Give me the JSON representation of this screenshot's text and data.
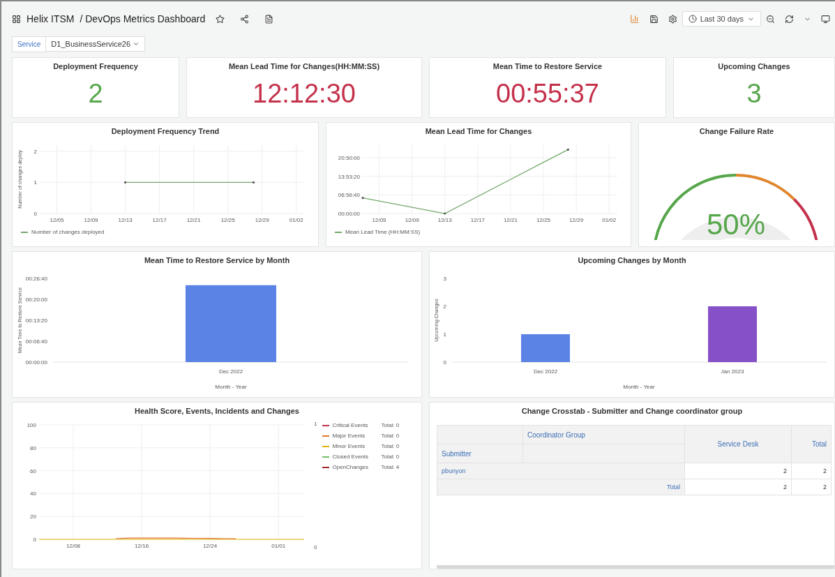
{
  "header": {
    "folder": "Helix ITSM",
    "title": "/ DevOps Metrics Dashboard",
    "time_range": "Last 30 days"
  },
  "variables": [
    {
      "label": "Service",
      "value": "D1_BusinessService26"
    }
  ],
  "stats": [
    {
      "title": "Deployment Frequency",
      "value": "2",
      "color": "#56a64b"
    },
    {
      "title": "Mean Lead Time for Changes(HH:MM:SS)",
      "value": "12:12:30",
      "color": "#c4314b"
    },
    {
      "title": "Mean Time to Restore Service",
      "value": "00:55:37",
      "color": "#c4314b"
    },
    {
      "title": "Upcoming Changes",
      "value": "3",
      "color": "#56a64b"
    }
  ],
  "deployment_trend": {
    "title": "Deployment Frequency Trend",
    "chart_data": {
      "type": "line",
      "grid": true,
      "ylabel": "Number of changes deploy",
      "ylim": [
        0,
        2.2
      ],
      "yticks": [
        0,
        1,
        2
      ],
      "categories": [
        null,
        null,
        "12/05",
        null,
        null,
        null,
        "12/09",
        null,
        null,
        null,
        "12/13",
        null,
        null,
        null,
        "12/17",
        null,
        null,
        null,
        "12/21",
        null,
        null,
        null,
        "12/25",
        null,
        null,
        null,
        "12/29",
        null,
        null,
        null,
        "01/02",
        null
      ],
      "series": [
        {
          "name": "Number of changes deployed",
          "color": "#73a86a",
          "values": [
            null,
            null,
            null,
            null,
            null,
            null,
            null,
            null,
            null,
            null,
            1,
            null,
            null,
            null,
            null,
            null,
            null,
            null,
            null,
            null,
            null,
            null,
            null,
            null,
            null,
            1,
            null,
            null,
            null,
            null,
            null,
            null
          ]
        }
      ]
    }
  },
  "lead_time": {
    "title": "Mean Lead Time for Changes",
    "chart_data": {
      "type": "line",
      "grid": true,
      "ylim": [
        0,
        92000
      ],
      "yticks": [
        {
          "value": 0,
          "label": "00:00:00"
        },
        {
          "value": 25000,
          "label": "06:56:40"
        },
        {
          "value": 50000,
          "label": "13:53:20"
        },
        {
          "value": 75000,
          "label": "20:50:00"
        }
      ],
      "categories": [
        null,
        null,
        "12/05",
        null,
        null,
        null,
        "12/09",
        null,
        null,
        null,
        "12/13",
        null,
        null,
        null,
        "12/17",
        null,
        null,
        null,
        "12/21",
        null,
        null,
        null,
        "12/25",
        null,
        null,
        null,
        "12/29",
        null,
        null,
        null,
        "01/02",
        null
      ],
      "series": [
        {
          "name": "Mean Lead Time (HH:MM:SS)",
          "color": "#73a86a",
          "values": [
            21000,
            null,
            null,
            null,
            null,
            null,
            null,
            null,
            null,
            null,
            0,
            null,
            null,
            null,
            null,
            null,
            null,
            null,
            null,
            null,
            null,
            null,
            null,
            null,
            null,
            86000,
            null,
            null,
            null,
            null,
            null,
            null
          ]
        }
      ]
    }
  },
  "failure_rate": {
    "title": "Change Failure Rate",
    "value": "50%"
  },
  "restore_by_month": {
    "title": "Mean Time to Restore Service by Month",
    "chart_data": {
      "type": "bar",
      "xlabel": "Month - Year",
      "ylabel": "Mean Time to Restore Service",
      "categories": [
        "Dec 2022"
      ],
      "ylim": [
        0,
        1600
      ],
      "yticks": [
        {
          "value": 0,
          "label": "00:00:00"
        },
        {
          "value": 400,
          "label": "00:06:40"
        },
        {
          "value": 800,
          "label": "00:13:20"
        },
        {
          "value": 1200,
          "label": "00:20:00"
        },
        {
          "value": 1600,
          "label": "00:26:40"
        }
      ],
      "series": [
        {
          "color": "#5b83e6",
          "values": [
            1470
          ]
        }
      ]
    }
  },
  "upcoming_by_month": {
    "title": "Upcoming Changes by Month",
    "chart_data": {
      "type": "bar",
      "xlabel": "Month - Year",
      "ylabel": "Upcoming Changes",
      "categories": [
        "Dec 2022",
        "Jan 2023"
      ],
      "ylim": [
        0,
        3
      ],
      "yticks": [
        0,
        1,
        2,
        3
      ],
      "series": [
        {
          "color": "#5b83e6",
          "values": [
            1,
            null
          ]
        },
        {
          "color": "#8650c8",
          "values": [
            null,
            2
          ]
        }
      ]
    }
  },
  "health": {
    "title": "Health Score, Events, Incidents and Changes",
    "right_axis_ticks": [
      "1",
      "0"
    ],
    "legend": [
      {
        "name": "Critical Events",
        "total": "Total: 0",
        "color": "#c4314b"
      },
      {
        "name": "Major Events",
        "total": "Total: 0",
        "color": "#e0752d"
      },
      {
        "name": "Minor Events",
        "total": "Total: 0",
        "color": "#e0b400"
      },
      {
        "name": "Closed Events",
        "total": "Total: 0",
        "color": "#73bf69"
      },
      {
        "name": "OpenChanges",
        "total": "Total: 4",
        "color": "#a0282b"
      }
    ],
    "chart_data": {
      "type": "line",
      "ylim": [
        0,
        100
      ],
      "yticks": [
        0,
        20,
        40,
        60,
        80,
        100
      ],
      "categories": [
        null,
        null,
        null,
        null,
        "12/08",
        null,
        null,
        null,
        null,
        null,
        null,
        null,
        "12/16",
        null,
        null,
        null,
        null,
        null,
        null,
        null,
        "12/24",
        null,
        null,
        null,
        null,
        null,
        null,
        null,
        "01/01",
        null,
        null,
        null
      ],
      "grid": true,
      "series": [
        {
          "color": "#e0b400",
          "values": [
            0,
            0,
            0,
            0,
            0,
            0,
            0,
            0,
            0,
            0,
            0,
            0,
            0,
            0,
            0,
            0,
            0,
            0,
            0,
            0,
            0,
            0,
            0,
            0,
            0,
            0,
            0,
            0,
            0,
            0,
            0,
            0
          ]
        },
        {
          "color": "#e0752d",
          "values": [
            null,
            null,
            null,
            null,
            null,
            null,
            null,
            null,
            null,
            0.6,
            1,
            1.2,
            1.2,
            1.2,
            1.2,
            1.2,
            1.1,
            1,
            0.9,
            0.9,
            0.8,
            0.7,
            0.6,
            0.5,
            null,
            null,
            null,
            null,
            null,
            null,
            null,
            null
          ]
        }
      ]
    }
  },
  "crosstab": {
    "title": "Change Crosstab - Submitter and Change coordinator group",
    "column_group": "Coordinator Group",
    "row_header": "Submitter",
    "columns": [
      "Service Desk",
      "Total"
    ],
    "rows": [
      {
        "label": "pbunyon",
        "cells": [
          "2",
          "2"
        ]
      }
    ],
    "total_row": {
      "label": "Total",
      "cells": [
        "2",
        "2"
      ]
    }
  }
}
